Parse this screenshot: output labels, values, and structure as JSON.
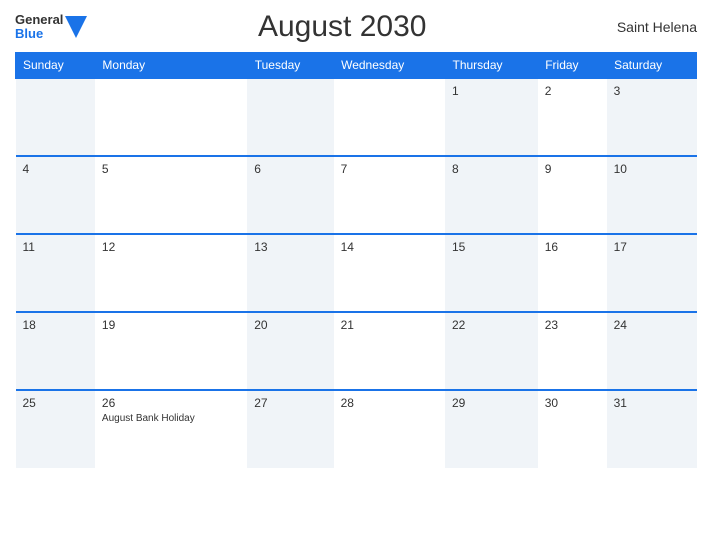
{
  "header": {
    "logo_general": "General",
    "logo_blue": "Blue",
    "title": "August 2030",
    "region": "Saint Helena"
  },
  "weekdays": [
    "Sunday",
    "Monday",
    "Tuesday",
    "Wednesday",
    "Thursday",
    "Friday",
    "Saturday"
  ],
  "weeks": [
    [
      {
        "day": "",
        "event": ""
      },
      {
        "day": "",
        "event": ""
      },
      {
        "day": "",
        "event": ""
      },
      {
        "day": "",
        "event": ""
      },
      {
        "day": "1",
        "event": ""
      },
      {
        "day": "2",
        "event": ""
      },
      {
        "day": "3",
        "event": ""
      }
    ],
    [
      {
        "day": "4",
        "event": ""
      },
      {
        "day": "5",
        "event": ""
      },
      {
        "day": "6",
        "event": ""
      },
      {
        "day": "7",
        "event": ""
      },
      {
        "day": "8",
        "event": ""
      },
      {
        "day": "9",
        "event": ""
      },
      {
        "day": "10",
        "event": ""
      }
    ],
    [
      {
        "day": "11",
        "event": ""
      },
      {
        "day": "12",
        "event": ""
      },
      {
        "day": "13",
        "event": ""
      },
      {
        "day": "14",
        "event": ""
      },
      {
        "day": "15",
        "event": ""
      },
      {
        "day": "16",
        "event": ""
      },
      {
        "day": "17",
        "event": ""
      }
    ],
    [
      {
        "day": "18",
        "event": ""
      },
      {
        "day": "19",
        "event": ""
      },
      {
        "day": "20",
        "event": ""
      },
      {
        "day": "21",
        "event": ""
      },
      {
        "day": "22",
        "event": ""
      },
      {
        "day": "23",
        "event": ""
      },
      {
        "day": "24",
        "event": ""
      }
    ],
    [
      {
        "day": "25",
        "event": ""
      },
      {
        "day": "26",
        "event": "August Bank Holiday"
      },
      {
        "day": "27",
        "event": ""
      },
      {
        "day": "28",
        "event": ""
      },
      {
        "day": "29",
        "event": ""
      },
      {
        "day": "30",
        "event": ""
      },
      {
        "day": "31",
        "event": ""
      }
    ]
  ]
}
